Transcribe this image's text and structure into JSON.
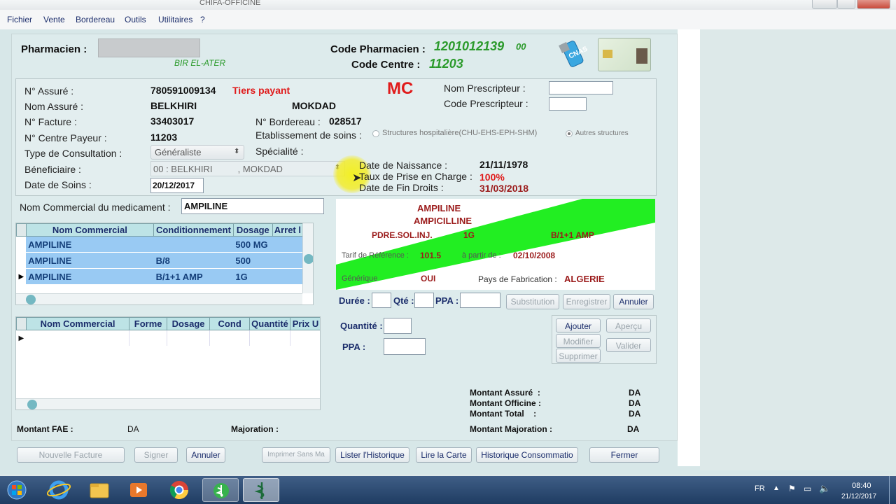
{
  "window": {
    "title": "CHIFA-OFFICINE"
  },
  "menu": [
    "Fichier",
    "Vente",
    "Bordereau",
    "Outils",
    "Utilitaires",
    "?"
  ],
  "header": {
    "pharmacien_label": "Pharmacien :",
    "location": "BIR EL-ATER",
    "code_pharmacien_label": "Code Pharmacien :",
    "code_pharmacien": "1201012139",
    "code_pharmacien_suffix": "00",
    "code_centre_label": "Code Centre :",
    "code_centre": "11203",
    "logo_text": "CNAS"
  },
  "assure": {
    "n_assure_label": "N° Assuré :",
    "n_assure": "780591009134",
    "tiers_payant": "Tiers payant",
    "mc": "MC",
    "nom_assure_label": "Nom Assuré :",
    "nom": "BELKHIRI",
    "prenom": "MOKDAD",
    "n_facture_label": "N° Facture :",
    "n_facture": "33403017",
    "n_bordereau_label": "N° Bordereau :",
    "n_bordereau": "028517",
    "n_centre_payeur_label": "N° Centre Payeur :",
    "n_centre_payeur": "11203",
    "etablissement_label": "Etablissement de soins :",
    "etab_option1": "Structures hospitalière(CHU-EHS-EPH-SHM)",
    "etab_option2": "Autres structures",
    "type_consultation_label": "Type de Consultation :",
    "type_consultation": "Généraliste",
    "specialite_label": "Spécialité :",
    "beneficiaire_label": "Béneficiaire :",
    "beneficiaire": "00 : BELKHIRI          , MOKDAD",
    "date_soins_label": "Date de Soins :",
    "date_soins": "20/12/2017",
    "nom_prescripteur_label": "Nom  Prescripteur :",
    "code_prescripteur_label": "Code Prescripteur :",
    "date_naissance_label": "Date de Naissance :",
    "date_naissance": "21/11/1978",
    "taux_label": "Taux de Prise en Charge :",
    "taux": "100%",
    "date_fin_label": "Date de Fin Droits :",
    "date_fin": "31/03/2018"
  },
  "medicament": {
    "nom_commercial_label": "Nom Commercial du medicament :",
    "nom_commercial": "AMPILINE",
    "columns": [
      "Nom Commercial",
      "Conditionnement",
      "Dosage",
      "Arret l"
    ],
    "rows": [
      [
        "AMPILINE",
        "",
        "500 MG"
      ],
      [
        "AMPILINE",
        "B/8",
        "500"
      ],
      [
        "AMPILINE",
        "B/1+1 AMP",
        "1G"
      ]
    ]
  },
  "detail": {
    "nom": "AMPILINE",
    "dci": "AMPICILLINE",
    "forme": "PDRE.SOL.INJ.",
    "dosage": "1G",
    "cond": "B/1+1 AMP",
    "tarif_label": "Tarif de Référence :",
    "tarif": "101.5",
    "a_partir_label": "à partir de :",
    "a_partir": "02/10/2008",
    "generique_label": "Générique",
    "generique": "OUI",
    "pays_label": "Pays de Fabrication :",
    "pays": "ALGERIE",
    "accent": "#22ee22"
  },
  "saisie": {
    "duree_label": "Durée :",
    "qte_label": "Qté :",
    "ppa_label": "PPA :",
    "substitution": "Substitution",
    "enregistrer": "Enregistrer",
    "annuler": "Annuler"
  },
  "facture": {
    "columns": [
      "Nom Commercial",
      "Forme",
      "Dosage",
      "Cond",
      "Quantité",
      "Prix U"
    ],
    "quantite_label": "Quantité :",
    "ppa_label": "PPA :",
    "ajouter": "Ajouter",
    "apercu": "Aperçu",
    "modifier": "Modifier",
    "valider": "Valider",
    "supprimer": "Supprimer"
  },
  "montants": {
    "assure_label": "Montant Assuré  :",
    "officine_label": "Montant Officine :",
    "total_label": "Montant Total    :",
    "majoration_montant_label": "Montant Majoration :",
    "da": "DA",
    "fae_label": "Montant FAE :",
    "fae_da": "DA",
    "majoration_label": "Majoration :"
  },
  "actions": {
    "nouvelle_facture": "Nouvelle Facture",
    "signer": "Signer",
    "annuler": "Annuler",
    "imprimer": "Imprimer Sans Ma",
    "lister": "Lister l'Historique",
    "lire_carte": "Lire la Carte",
    "historique": "Historique Consommatio",
    "fermer": "Fermer"
  },
  "taskbar": {
    "lang": "FR",
    "time": "08:40",
    "date": "21/12/2017"
  }
}
